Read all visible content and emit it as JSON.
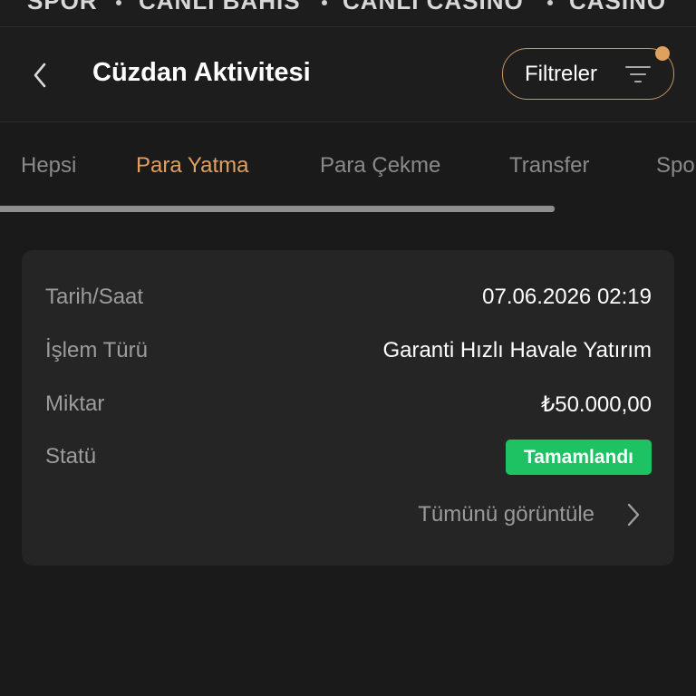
{
  "top_nav": {
    "items": [
      "SPOR",
      "CANLI BAHİS",
      "CANLI CASINO",
      "CASINO"
    ]
  },
  "header": {
    "title": "Cüzdan Aktivitesi",
    "filter_label": "Filtreler",
    "back_icon": "chevron-left-icon",
    "filter_icon": "filter-lines-icon"
  },
  "tabs": {
    "items": [
      "Hepsi",
      "Para Yatma",
      "Para Çekme",
      "Transfer",
      "Spor"
    ],
    "active": "Para Yatma"
  },
  "transaction": {
    "labels": {
      "date": "Tarih/Saat",
      "type": "İşlem Türü",
      "amount": "Miktar",
      "status": "Statü"
    },
    "values": {
      "date": "07.06.2026 02:19",
      "type": "Garanti Hızlı Havale Yatırım",
      "amount": "₺50.000,00",
      "status": "Tamamlandı"
    },
    "view_all": "Tümünü görüntüle"
  },
  "colors": {
    "accent": "#e0a060",
    "success": "#1fc262",
    "background": "#1a1a1a",
    "card": "#252525"
  }
}
